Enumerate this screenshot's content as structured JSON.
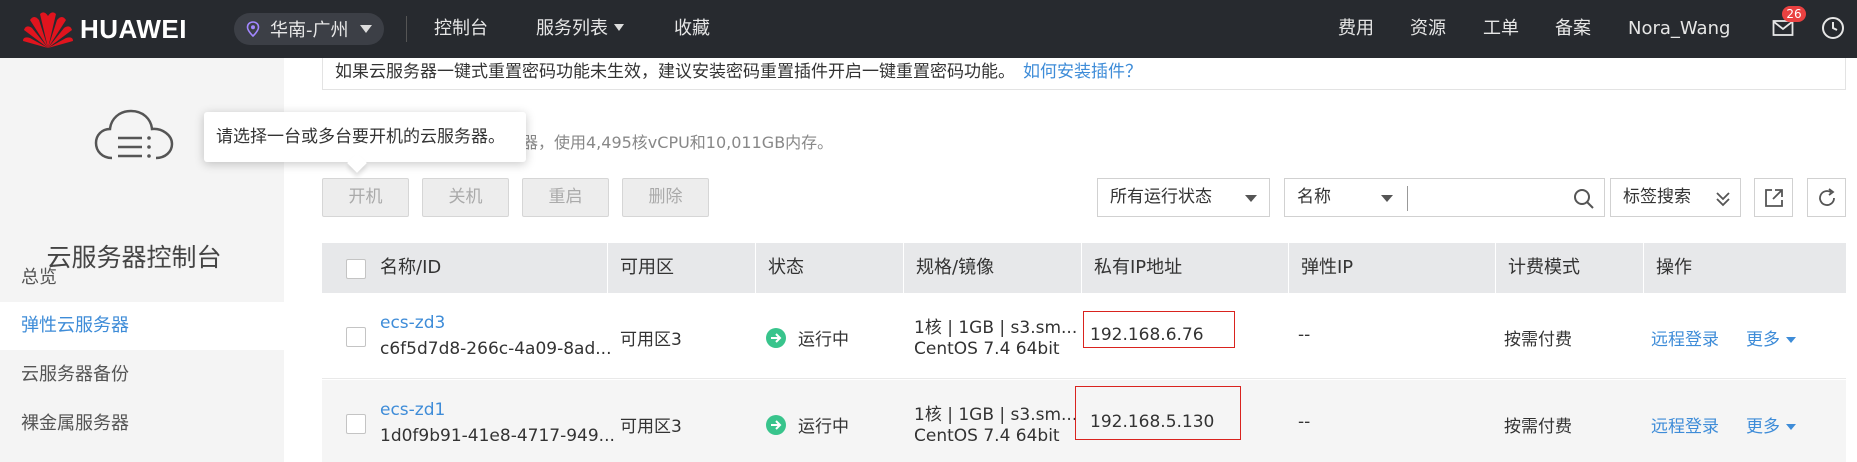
{
  "topbar": {
    "brand": "HUAWEI",
    "region": "华南-广州",
    "nav": {
      "console": "控制台",
      "services": "服务列表",
      "favorites": "收藏"
    },
    "right": {
      "billing": "费用",
      "resources": "资源",
      "tickets": "工单",
      "filing": "备案",
      "user": "Nora_Wang"
    },
    "badge_count": "26"
  },
  "sidebar": {
    "title": "云服务器控制台",
    "items": [
      {
        "label": "总览",
        "active": false
      },
      {
        "label": "弹性云服务器",
        "active": true
      },
      {
        "label": "云服务器备份",
        "active": false
      },
      {
        "label": "裸金属服务器",
        "active": false
      }
    ]
  },
  "notice": {
    "text": "如果云服务器一键式重置密码功能未生效，建议安装密码重置插件开启一键重置密码功能。",
    "link": "如何安装插件？"
  },
  "summary": "器，使用4,495核vCPU和10,011GB内存。",
  "tooltip": "请选择一台或多台要开机的云服务器。",
  "toolbar": {
    "start": "开机",
    "stop": "关机",
    "restart": "重启",
    "delete": "删除",
    "status_filter": "所有运行状态",
    "search_field": "名称",
    "search_placeholder": "",
    "tag_search": "标签搜索"
  },
  "table": {
    "headers": [
      "名称/ID",
      "可用区",
      "状态",
      "规格/镜像",
      "私有IP地址",
      "弹性IP",
      "计费模式",
      "操作"
    ],
    "rows": [
      {
        "name": "ecs-zd3",
        "id": "c6f5d7d8-266c-4a09-8ad...",
        "zone": "可用区3",
        "status": "运行中",
        "spec": "1核 | 1GB | s3.sm...",
        "image": "CentOS 7.4 64bit",
        "private_ip": "192.168.6.76",
        "eip": "--",
        "billing": "按需付费",
        "remote": "远程登录",
        "more": "更多"
      },
      {
        "name": "ecs-zd1",
        "id": "1d0f9b91-41e8-4717-949...",
        "zone": "可用区3",
        "status": "运行中",
        "spec": "1核 | 1GB | s3.sm...",
        "image": "CentOS 7.4 64bit",
        "private_ip": "192.168.5.130",
        "eip": "--",
        "billing": "按需付费",
        "remote": "远程登录",
        "more": "更多"
      }
    ]
  },
  "colors": {
    "topbar_bg": "#272a2f",
    "accent_link": "#3e8cd8",
    "running_green": "#38c48c",
    "highlight_red": "#d9231e",
    "huawei_red": "#e0141e"
  },
  "icons": [
    "huawei-logo-icon",
    "location-pin-icon",
    "mail-icon",
    "clock-icon",
    "cloud-server-icon",
    "search-icon",
    "export-icon",
    "refresh-icon",
    "double-chevron-down-icon",
    "running-arrow-icon"
  ]
}
